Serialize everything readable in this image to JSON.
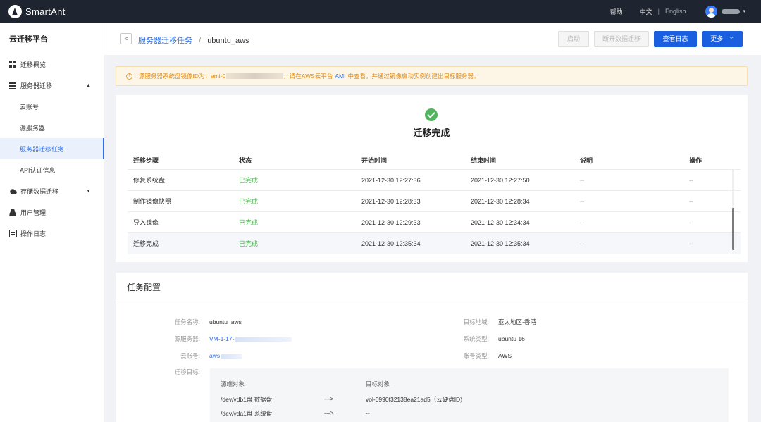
{
  "topbar": {
    "brand": "SmartAnt",
    "help": "帮助",
    "lang_zh": "中文",
    "lang_sep": "|",
    "lang_en": "English",
    "user_caret": "▾"
  },
  "sidebar": {
    "title": "云迁移平台",
    "items": [
      {
        "label": "迁移概览",
        "icon": "grid-icon"
      },
      {
        "label": "服务器迁移",
        "icon": "server-icon",
        "expanded": true,
        "arrow": "▲"
      },
      {
        "label": "云账号"
      },
      {
        "label": "源服务器"
      },
      {
        "label": "服务器迁移任务",
        "active": true
      },
      {
        "label": "API认证信息"
      },
      {
        "label": "存储数据迁移",
        "icon": "cloud-icon",
        "arrow": "▼"
      },
      {
        "label": "用户管理",
        "icon": "user-icon"
      },
      {
        "label": "操作日志",
        "icon": "log-icon"
      }
    ]
  },
  "header": {
    "back": "<",
    "crumb_parent": "服务器迁移任务",
    "crumb_sep": "/",
    "crumb_current": "ubuntu_aws",
    "btn_start": "启动",
    "btn_disconnect": "断开数据迁移",
    "btn_log": "查看日志",
    "btn_more": "更多",
    "btn_more_caret": "﹀"
  },
  "alert": {
    "icon": "!",
    "prefix": "源服务器系统盘镜像ID为：ami-0",
    "middle": "，请在AWS云平台",
    "ami": "AMI",
    "suffix": "中查看，并通过镜像启动实例创建出目标服务器。"
  },
  "migration": {
    "status_title": "迁移完成",
    "columns": [
      "迁移步骤",
      "状态",
      "开始时间",
      "结束时间",
      "说明",
      "操作"
    ],
    "rows": [
      {
        "step": "修复系统盘",
        "status": "已完成",
        "start": "2021-12-30 12:27:36",
        "end": "2021-12-30 12:27:50",
        "note": "--",
        "op": "--"
      },
      {
        "step": "制作镜像快照",
        "status": "已完成",
        "start": "2021-12-30 12:28:33",
        "end": "2021-12-30 12:28:34",
        "note": "--",
        "op": "--"
      },
      {
        "step": "导入镜像",
        "status": "已完成",
        "start": "2021-12-30 12:29:33",
        "end": "2021-12-30 12:34:34",
        "note": "--",
        "op": "--"
      },
      {
        "step": "迁移完成",
        "status": "已完成",
        "start": "2021-12-30 12:35:34",
        "end": "2021-12-30 12:35:34",
        "note": "--",
        "op": "--"
      }
    ]
  },
  "config": {
    "title": "任务配置",
    "task_name_label": "任务名称:",
    "task_name": "ubuntu_aws",
    "source_server_label": "源服务器:",
    "source_server": "VM-1-17-",
    "cloud_account_label": "云账号:",
    "cloud_account": "aws",
    "target_label": "迁移目标:",
    "region_label": "目标地域:",
    "region": "亚太地区-香港",
    "os_label": "系统类型:",
    "os": "ubuntu 16",
    "account_type_label": "账号类型:",
    "account_type": "AWS",
    "target": {
      "src_header": "源端对象",
      "dst_header": "目标对象",
      "rows": [
        {
          "src": "/dev/vdb1盘   数据盘",
          "arrow": "--->",
          "dst": "vol-0990f32138ea21ad5（云硬盘ID)"
        },
        {
          "src": "/dev/vda1盘   系统盘",
          "arrow": "--->",
          "dst": "--"
        }
      ]
    }
  }
}
